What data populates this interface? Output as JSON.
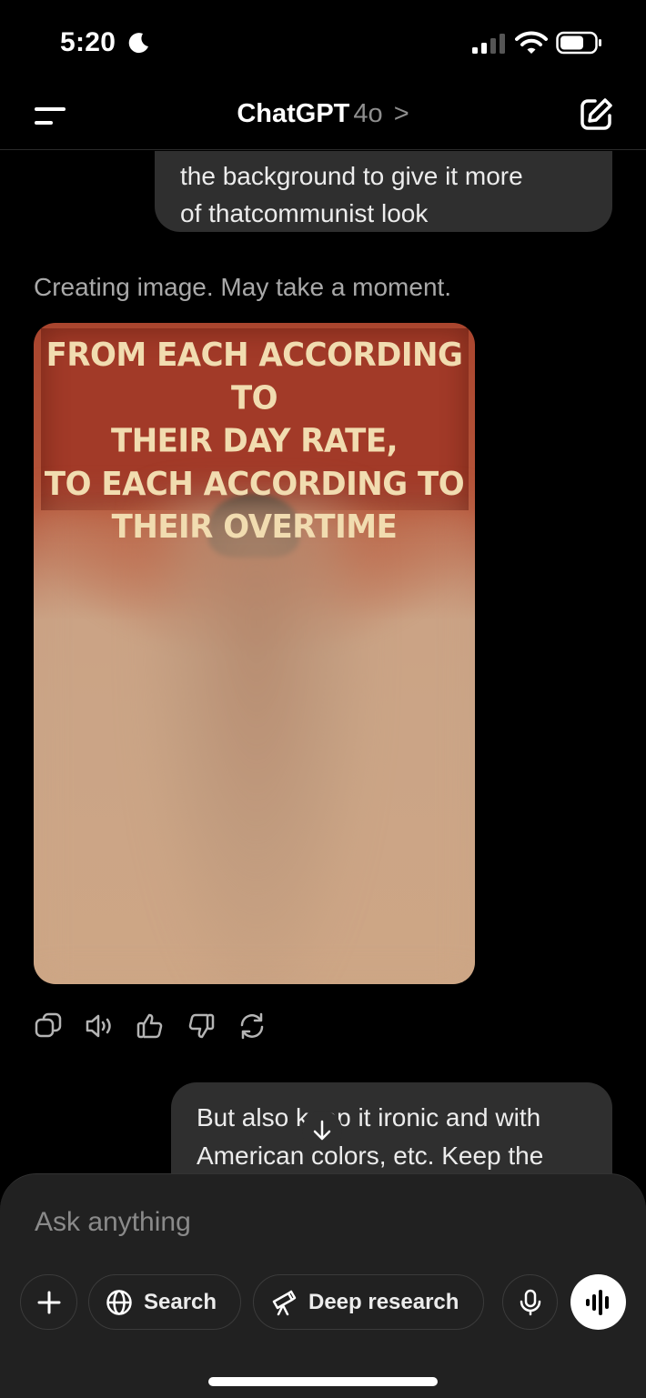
{
  "status_bar": {
    "time": "5:20",
    "icons": [
      "moon-icon",
      "signal-icon",
      "wifi-icon",
      "battery-icon"
    ]
  },
  "header": {
    "title": "ChatGPT",
    "model": "4o",
    "chevron": ">",
    "icons": [
      "menu-icon",
      "edit-icon"
    ]
  },
  "messages": {
    "user_1_lines": [
      "the background to give it more",
      "of thatcommunist look"
    ],
    "status": "Creating image. May take a moment.",
    "poster_text_lines": [
      "FROM EACH ACCORDING TO",
      "THEIR DAY RATE,",
      "TO EACH ACCORDING TO",
      "THEIR OVERTIME"
    ],
    "actions": [
      "copy-icon",
      "read-aloud-icon",
      "thumbs-up-icon",
      "thumbs-down-icon",
      "regenerate-icon"
    ],
    "user_2_lines": [
      "But also keep it ironic and with",
      "American colors, etc. Keep the"
    ]
  },
  "composer": {
    "placeholder": "Ask anything",
    "search_label": "Search",
    "deep_research_label": "Deep research",
    "icons": [
      "plus-icon",
      "globe-icon",
      "telescope-icon",
      "mic-icon",
      "voice-waveform-icon"
    ]
  },
  "colors": {
    "background": "#000000",
    "bubble": "#2f2f2f",
    "composer": "#212121",
    "muted_text": "#a9a9a9",
    "poster_red": "#a23a28",
    "poster_text": "#f1dcb0"
  }
}
